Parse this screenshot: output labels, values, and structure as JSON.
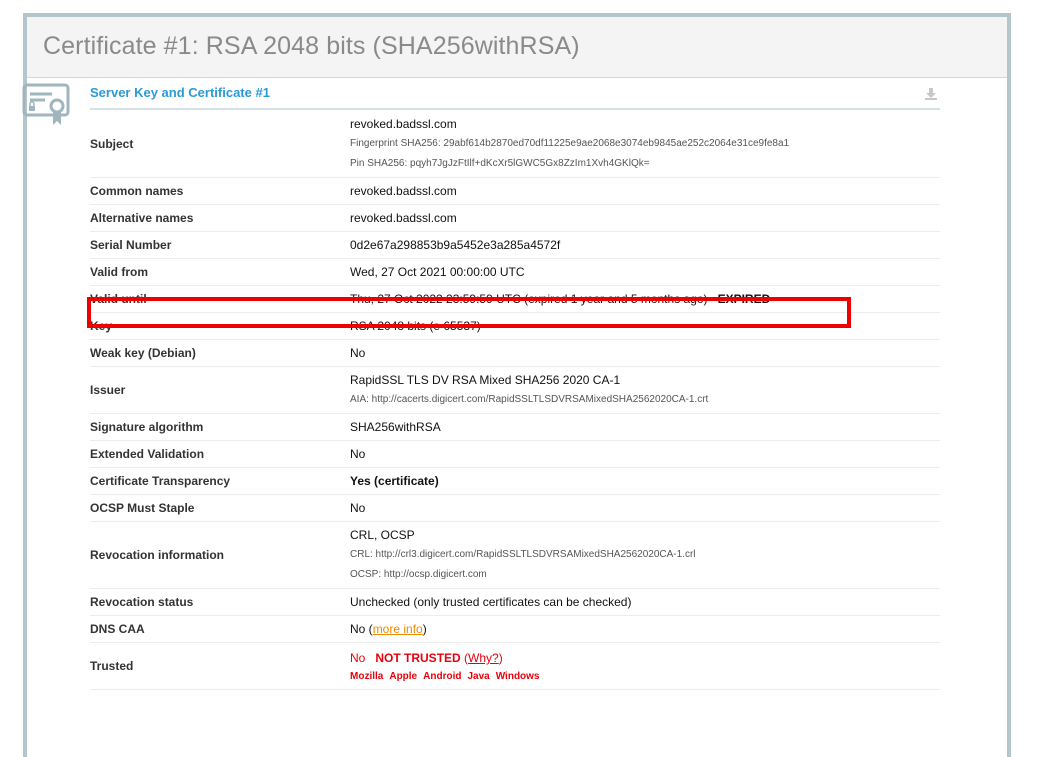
{
  "header": {
    "title": "Certificate #1: RSA 2048 bits (SHA256withRSA)"
  },
  "section": {
    "title": "Server Key and Certificate #1"
  },
  "colors": {
    "red": "#e8000b",
    "green": "#18891b",
    "orange": "#f08a00",
    "link_blue": "#2a9ad8"
  },
  "rows": {
    "subject": {
      "label": "Subject",
      "value": "revoked.badssl.com",
      "fingerprint": "Fingerprint SHA256: 29abf614b2870ed70df11225e9ae2068e3074eb9845ae252c2064e31ce9fe8a1",
      "pin": "Pin SHA256: pqyh7JgJzFtIlf+dKcXr5lGWC5Gx8ZzIm1Xvh4GKlQk="
    },
    "common_names": {
      "label": "Common names",
      "value": "revoked.badssl.com"
    },
    "alt_names": {
      "label": "Alternative names",
      "value": "revoked.badssl.com"
    },
    "serial": {
      "label": "Serial Number",
      "value": "0d2e67a298853b9a5452e3a285a4572f"
    },
    "valid_from": {
      "label": "Valid from",
      "value": "Wed, 27 Oct 2021 00:00:00 UTC"
    },
    "valid_until": {
      "label": "Valid until",
      "value": "Thu, 27 Oct 2022 23:59:59 UTC (expired 1 year and 5 months ago)",
      "status": "EXPIRED"
    },
    "key": {
      "label": "Key",
      "value": "RSA 2048 bits (e 65537)"
    },
    "weak_key": {
      "label": "Weak key (Debian)",
      "value": "No"
    },
    "issuer": {
      "label": "Issuer",
      "value": "RapidSSL TLS DV RSA Mixed SHA256 2020 CA-1",
      "aia": "AIA: http://cacerts.digicert.com/RapidSSLTLSDVRSAMixedSHA2562020CA-1.crt"
    },
    "sig_alg": {
      "label": "Signature algorithm",
      "value": "SHA256withRSA"
    },
    "ev": {
      "label": "Extended Validation",
      "value": "No"
    },
    "ct": {
      "label": "Certificate Transparency",
      "value": "Yes (certificate)"
    },
    "ocsp_staple": {
      "label": "OCSP Must Staple",
      "value": "No"
    },
    "revocation_info": {
      "label": "Revocation information",
      "value": "CRL, OCSP",
      "crl": "CRL: http://crl3.digicert.com/RapidSSLTLSDVRSAMixedSHA2562020CA-1.crl",
      "ocsp": "OCSP: http://ocsp.digicert.com"
    },
    "revocation_status": {
      "label": "Revocation status",
      "value": "Unchecked (only trusted certificates can be checked)"
    },
    "dns_caa": {
      "label": "DNS CAA",
      "value": "No",
      "link": "more info"
    },
    "trusted": {
      "label": "Trusted",
      "value": "No",
      "status": "NOT TRUSTED",
      "link": "Why?",
      "stores": [
        "Mozilla",
        "Apple",
        "Android",
        "Java",
        "Windows"
      ]
    }
  }
}
